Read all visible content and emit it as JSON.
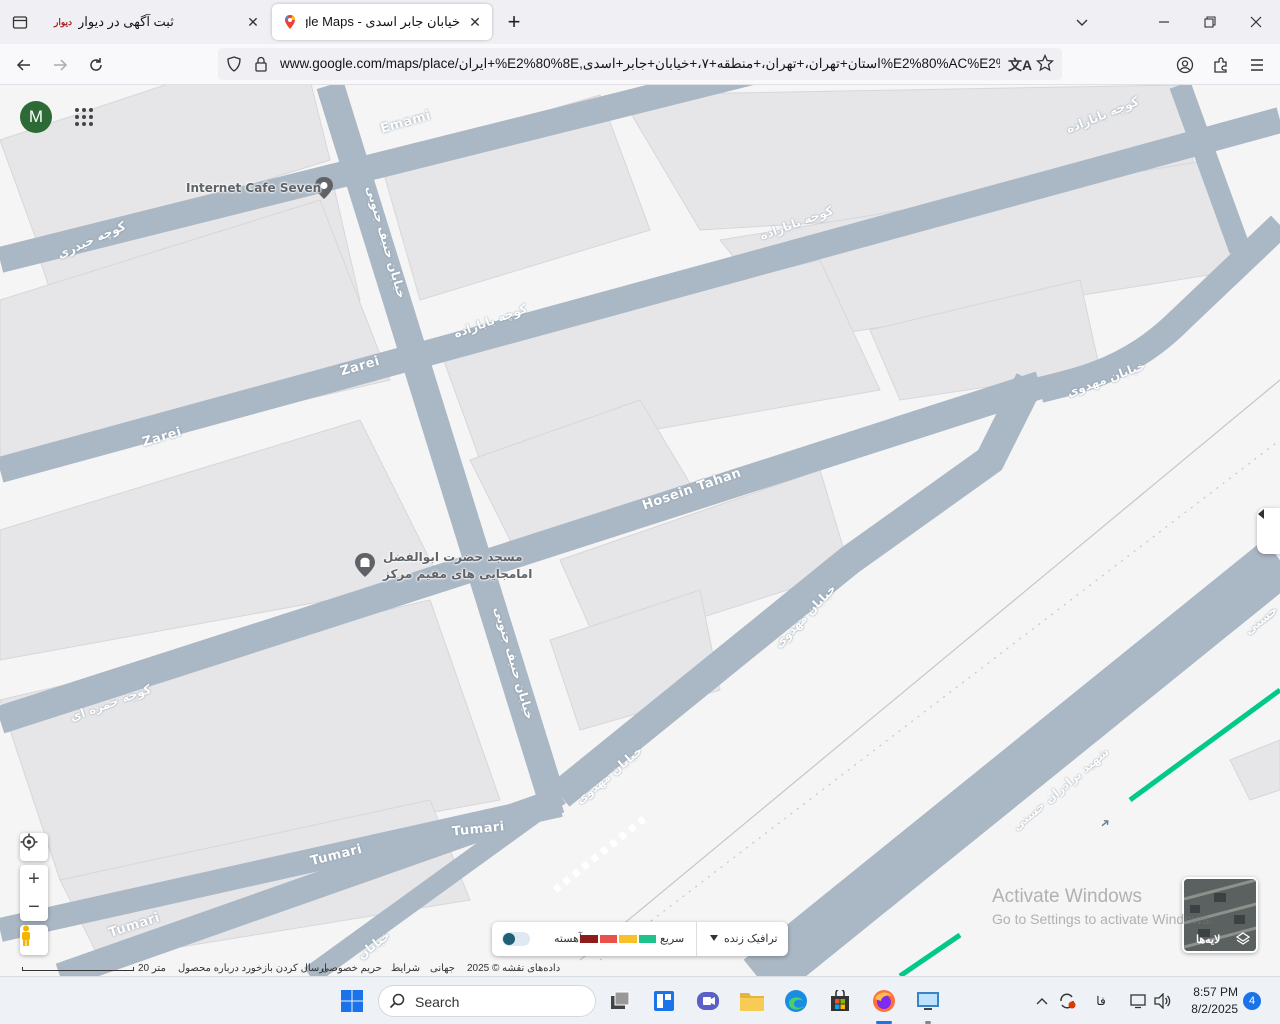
{
  "browser": {
    "tabs": [
      {
        "title": "ثبت آگهی در دیوار",
        "favicon": "divar-icon",
        "active": false
      },
      {
        "title": "خیابان جابر اسدی - Google Maps",
        "favicon": "google-maps-icon",
        "active": true
      }
    ],
    "new_tab_label": "+",
    "url": "www.google.com/maps/place/ایران+%E2%80%8E,استان+تهران،+تهران،+منطقه+۷،+خیابان+جابر+اسدی%E2%80%AC%E2%80%8E%E2%"
  },
  "map": {
    "account_initial": "M",
    "places": [
      {
        "name": "Internet Cafe Seven",
        "icon": "pin-icon"
      },
      {
        "name_line1": "مسجد حضرت ابوالفضل",
        "name_line2": "امامجایی های مقیم مرکز",
        "icon": "mosque-icon"
      }
    ],
    "streets": {
      "emami": "Emami",
      "zarei_1": "Zarei",
      "zarei_2": "Zarei",
      "hosein_tahan": "Hosein Tahan",
      "tumari_1": "Tumari",
      "tumari_2": "Tumari",
      "tumari_3": "Tumari",
      "heydari": "کوچه حیدری",
      "hanif_1": "خیابان حنیف جنوبی",
      "hanif_2": "خیابان حنیف جنوبی",
      "babazadeh_1": "کوچه بابازاده",
      "babazadeh_2": "کوچه بابازاده",
      "babazadeh_3": "کوچه بابازاده",
      "mahdavi_1": "خیابان مهدوی",
      "mahdavi_2": "خیابان مهدوی",
      "mahdavi_3": "خیابان مهدوی",
      "hamzeh": "کوچه حمزه ای",
      "baradaran_hasani": "شهید برادران حسنی",
      "hasani_edge": "حسنی",
      "khiaban_edge": "خیابان"
    },
    "traffic": {
      "live_label": "ترافیک زنده",
      "fast_label": "سریع",
      "slow_label": "آهسته",
      "colors": [
        "#1ec28b",
        "#f8c02a",
        "#e8524a",
        "#8e1c1c"
      ]
    },
    "layers_label": "لایه‌ها",
    "footer": {
      "data": "داده‌های نقشه © 2025",
      "global": "جهانی",
      "terms": "شرایط",
      "privacy": "حریم خصوصی",
      "feedback": "ارسال کردن بازخورد درباره محصول",
      "scale": "20 متر"
    },
    "watermark": {
      "line1": "Activate Windows",
      "line2": "Go to Settings to activate Windows."
    }
  },
  "taskbar": {
    "search_placeholder": "Search",
    "language": "فا",
    "time": "8:57 PM",
    "date": "8/2/2025",
    "notification_count": "4"
  },
  "colors": {
    "road": "#aab7c4",
    "building": "#e8e8e8",
    "transit": "#00c98a",
    "account": "#2e6a35"
  }
}
